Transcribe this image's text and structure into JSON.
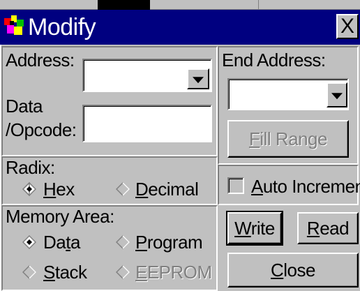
{
  "window": {
    "title": "Modify",
    "close_glyph": "X",
    "icon": "modify-app-icon",
    "title_bar_color": "#000080"
  },
  "address": {
    "label_text": "Address:",
    "value": ""
  },
  "data_opcode": {
    "label_line1": "Data",
    "label_line2": "/Opcode:",
    "value": ""
  },
  "end_address": {
    "label": "End Address:",
    "value": ""
  },
  "fill_range": {
    "pre": "",
    "accel": "F",
    "post": "ill Range",
    "enabled": false
  },
  "radix": {
    "label": "Radix:",
    "options": [
      {
        "pre": "",
        "accel": "H",
        "post": "ex",
        "selected": true,
        "enabled": true
      },
      {
        "pre": "",
        "accel": "D",
        "post": "ecimal",
        "selected": false,
        "enabled": true
      }
    ]
  },
  "auto_increment": {
    "pre": "",
    "accel": "A",
    "post": "uto Increment",
    "checked": false
  },
  "memory_area": {
    "label": "Memory Area:",
    "options": [
      {
        "pre": "Da",
        "accel": "t",
        "post": "a",
        "selected": true,
        "enabled": true
      },
      {
        "pre": "",
        "accel": "P",
        "post": "rogram",
        "selected": false,
        "enabled": true
      },
      {
        "pre": "",
        "accel": "S",
        "post": "tack",
        "selected": false,
        "enabled": true
      },
      {
        "pre": "",
        "accel": "E",
        "post": "EPROM",
        "selected": false,
        "enabled": false
      }
    ]
  },
  "buttons": {
    "write": {
      "pre": "",
      "accel": "W",
      "post": "rite"
    },
    "read": {
      "pre": "",
      "accel": "R",
      "post": "ead"
    },
    "close": {
      "pre": "",
      "accel": "C",
      "post": "lose"
    }
  }
}
